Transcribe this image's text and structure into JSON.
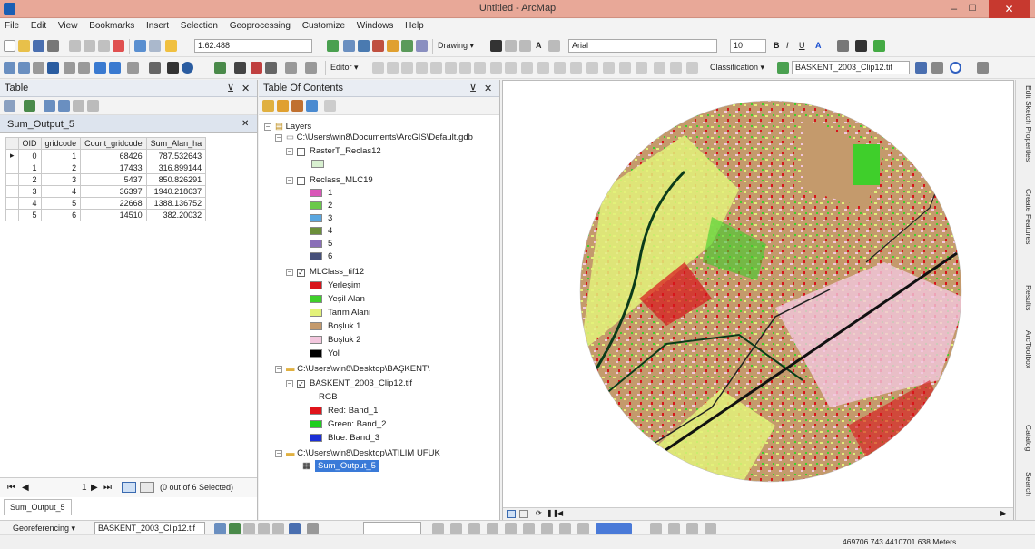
{
  "window": {
    "title": "Untitled - ArcMap",
    "min": "–",
    "max": "☐",
    "close": "✕"
  },
  "menu": [
    "File",
    "Edit",
    "View",
    "Bookmarks",
    "Insert",
    "Selection",
    "Geoprocessing",
    "Customize",
    "Windows",
    "Help"
  ],
  "toolbar1": {
    "scale": "1:62.488",
    "drawing": "Drawing ▾",
    "font": "Arial",
    "font_size": "10",
    "bold": "B",
    "italic": "I",
    "underline": "U"
  },
  "toolbar2": {
    "editor": "Editor ▾",
    "classification": "Classification ▾",
    "layer": "BASKENT_2003_Clip12.tif"
  },
  "table_panel": {
    "title": "Table",
    "tab": "Sum_Output_5",
    "columns": [
      "OID",
      "gridcode",
      "Count_gridcode",
      "Sum_Alan_ha"
    ],
    "rows": [
      [
        "0",
        "1",
        "68426",
        "787.532643"
      ],
      [
        "1",
        "2",
        "17433",
        "316.899144"
      ],
      [
        "2",
        "3",
        "5437",
        "850.826291"
      ],
      [
        "3",
        "4",
        "36397",
        "1940.218637"
      ],
      [
        "4",
        "5",
        "22668",
        "1388.136752"
      ],
      [
        "5",
        "6",
        "14510",
        "382.20032"
      ]
    ],
    "record_pos": "1",
    "selection_status": "(0 out of 6 Selected)",
    "bottom_tab": "Sum_Output_5"
  },
  "toc": {
    "title": "Table Of Contents",
    "layers_root": "Layers",
    "gdb_path": "C:\\Users\\win8\\Documents\\ArcGIS\\Default.gdb",
    "raster_reclas": "RasterT_Reclas12",
    "reclass_layer": "Reclass_MLC19",
    "reclass_classes": [
      {
        "label": "1",
        "color": "#d957b8"
      },
      {
        "label": "2",
        "color": "#6ac94a"
      },
      {
        "label": "3",
        "color": "#5aa7e0"
      },
      {
        "label": "4",
        "color": "#6b8f3a"
      },
      {
        "label": "5",
        "color": "#8a6fb8"
      },
      {
        "label": "6",
        "color": "#47507a"
      }
    ],
    "mlclass_layer": "MLClass_tif12",
    "mlclass_classes": [
      {
        "label": "Yerleşim",
        "color": "#d8141b"
      },
      {
        "label": "Yeşil Alan",
        "color": "#3fcf2b"
      },
      {
        "label": "Tarım Alanı",
        "color": "#e3f27a"
      },
      {
        "label": "Boşluk 1",
        "color": "#c49a6c"
      },
      {
        "label": "Boşluk 2",
        "color": "#f3c7de"
      },
      {
        "label": "Yol",
        "color": "#000000"
      }
    ],
    "baskent_path": "C:\\Users\\win8\\Desktop\\BAŞKENT\\",
    "clip_layer": "BASKENT_2003_Clip12.tif",
    "rgb_label": "RGB",
    "bands": [
      {
        "label": "Red:   Band_1",
        "color": "#e0141b"
      },
      {
        "label": "Green: Band_2",
        "color": "#1fce1f"
      },
      {
        "label": "Blue:  Band_3",
        "color": "#1c2fd6"
      }
    ],
    "atilim_path": "C:\\Users\\win8\\Desktop\\ATILIM UFUK",
    "selected_table": "Sum_Output_5"
  },
  "dock_tabs": [
    "Edit Sketch Properties",
    "Create Features",
    "Results",
    "ArcToolbox",
    "Catalog",
    "Search"
  ],
  "georef": {
    "label": "Georeferencing ▾",
    "layer": "BASKENT_2003_Clip12.tif"
  },
  "status": {
    "coords": "469706.743  4410701.638 Meters"
  }
}
